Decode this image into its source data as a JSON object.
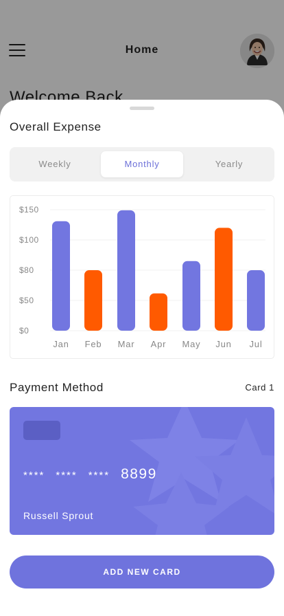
{
  "header": {
    "title": "Home",
    "menu_icon": "hamburger-menu-icon",
    "avatar": "user-avatar"
  },
  "background": {
    "welcome_text": "Welcome Back"
  },
  "expense": {
    "title": "Overall Expense",
    "tabs": [
      {
        "label": "Weekly",
        "active": false
      },
      {
        "label": "Monthly",
        "active": true
      },
      {
        "label": "Yearly",
        "active": false
      }
    ]
  },
  "chart_data": {
    "type": "bar",
    "categories": [
      "Jan",
      "Feb",
      "Mar",
      "Apr",
      "May",
      "Jun",
      "Jul"
    ],
    "values": [
      131,
      80,
      149,
      57,
      86,
      120,
      80
    ],
    "y_tick_labels": [
      "$0",
      "$50",
      "$80",
      "$100",
      "$150"
    ],
    "colors": [
      "#7276e0",
      "#ff5a00",
      "#7276e0",
      "#ff5a00",
      "#7276e0",
      "#ff5a00",
      "#7276e0"
    ],
    "grid": true,
    "title": "",
    "xlabel": "",
    "ylabel": ""
  },
  "payment": {
    "title": "Payment Method",
    "card_label": "Card 1",
    "card": {
      "masked_groups": [
        "****",
        "****",
        "****"
      ],
      "last4": "8899",
      "holder": "Russell Sprout",
      "color": "#7276e0"
    },
    "add_button_label": "ADD NEW CARD"
  },
  "colors": {
    "accent": "#7276e0",
    "accent_alt": "#ff5a00",
    "tab_active_text": "#6c70d8"
  }
}
